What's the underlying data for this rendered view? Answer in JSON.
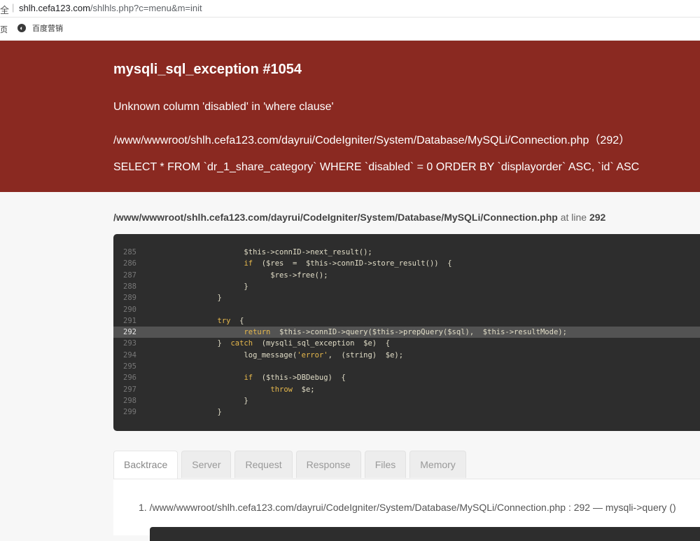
{
  "browser": {
    "address_prefix": "全",
    "address_host": "shlh.cefa123.com",
    "address_path": "/shlhls.php?c=menu&m=init",
    "bookmark_left": "页",
    "bookmark_label": "百度营销"
  },
  "error": {
    "title": "mysqli_sql_exception #1054",
    "message": "Unknown column 'disabled' in 'where clause'",
    "file": "/www/wwwroot/shlh.cefa123.com/dayrui/CodeIgniter/System/Database/MySQLi/Connection.php（292）",
    "sql": "SELECT * FROM `dr_1_share_category` WHERE `disabled` = 0 ORDER BY `displayorder` ASC, `id` ASC"
  },
  "source": {
    "path": "/www/wwwroot/shlh.cefa123.com/dayrui/CodeIgniter/System/Database/MySQLi/Connection.php",
    "at_line_label": "at line",
    "line": "292",
    "lines": [
      {
        "n": "285",
        "code": "                    $this->connID->next_result();"
      },
      {
        "n": "286",
        "code": "                    if  ($res  =  $this->connID->store_result())  {"
      },
      {
        "n": "287",
        "code": "                          $res->free();"
      },
      {
        "n": "288",
        "code": "                    }"
      },
      {
        "n": "289",
        "code": "              }"
      },
      {
        "n": "290",
        "code": ""
      },
      {
        "n": "291",
        "code": "              try  {"
      },
      {
        "n": "292",
        "code": "                    return  $this->connID->query($this->prepQuery($sql),  $this->resultMode);"
      },
      {
        "n": "293",
        "code": "              }  catch  (mysqli_sql_exception  $e)  {"
      },
      {
        "n": "294",
        "code": "                    log_message('error',  (string)  $e);"
      },
      {
        "n": "295",
        "code": ""
      },
      {
        "n": "296",
        "code": "                    if  ($this->DBDebug)  {"
      },
      {
        "n": "297",
        "code": "                          throw  $e;"
      },
      {
        "n": "298",
        "code": "                    }"
      },
      {
        "n": "299",
        "code": "              }"
      }
    ]
  },
  "tabs": [
    "Backtrace",
    "Server",
    "Request",
    "Response",
    "Files",
    "Memory"
  ],
  "backtrace": {
    "item": "1. /www/wwwroot/shlh.cefa123.com/dayrui/CodeIgniter/System/Database/MySQLi/Connection.php : 292  —  mysqli->query ()"
  }
}
